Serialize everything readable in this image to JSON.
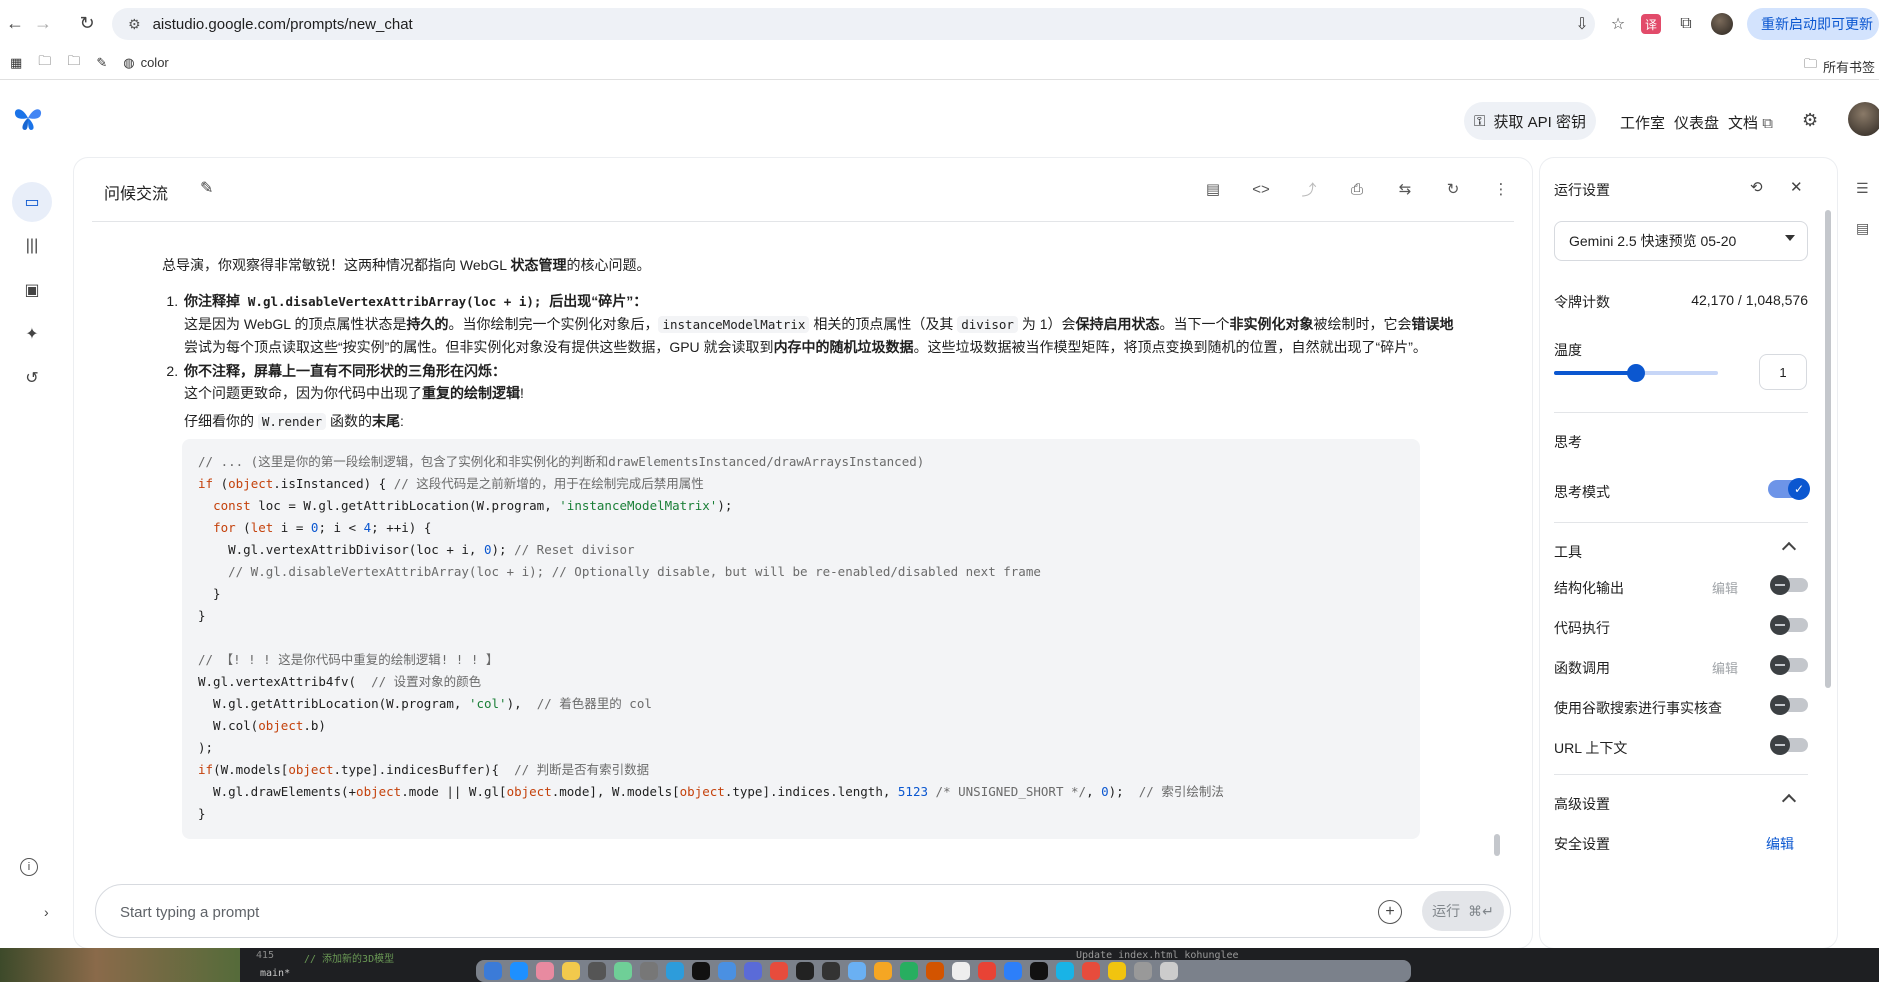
{
  "browser": {
    "url": "aistudio.google.com/prompts/new_chat",
    "update_label": "重新启动即可更新",
    "bookmarks": {
      "color": "color",
      "all_bookmarks": "所有书签"
    }
  },
  "header": {
    "api_key_label": "获取 API 密钥",
    "studio": "工作室",
    "dashboard": "仪表盘",
    "docs": "文档"
  },
  "chat": {
    "title": "问候交流",
    "intro_pre": "总导演，你观察得非常敏锐！这两种情况都指向 WebGL ",
    "intro_bold": "状态管理",
    "intro_post": "的核心问题。",
    "p1_head_pre": "你注释掉 ",
    "p1_head_code": "W.gl.disableVertexAttribArray(loc + i);",
    "p1_head_post": " 后出现“碎片”：",
    "p1_a": "这是因为 WebGL 的顶点属性状态是",
    "p1_b": "持久的",
    "p1_c": "。当你绘制完一个实例化对象后，",
    "p1_code1": "instanceModelMatrix",
    "p1_d": " 相关的顶点属性（及其 ",
    "p1_code2": "divisor",
    "p1_e": " 为 1）会",
    "p1_f": "保持启用状态",
    "p1_g": "。当下一个",
    "p1_h": "非实例化对象",
    "p1_i": "被绘制时，它会",
    "p1_j": "错误地",
    "p1_k": "尝试为每个顶点读取这些“按实例”的属性。但非实例化对象没有提供这些数据，GPU 就会读取到",
    "p1_l": "内存中的随机垃圾数据",
    "p1_m": "。这些垃圾数据被当作模型矩阵，将顶点变换到随机的位置，自然就出现了“碎片”。",
    "p2_head": "你不注释，屏幕上一直有不同形状的三角形在闪烁：",
    "p2_a": "这个问题更致命，因为你代码中出现了",
    "p2_b": "重复的绘制逻辑",
    "p2_c": "!",
    "p3_a": "仔细看你的 ",
    "p3_code": "W.render",
    "p3_b": " 函数的",
    "p3_c": "末尾",
    "p3_d": ":"
  },
  "code_lines": [
    "// ... (这里是你的第一段绘制逻辑，包含了实例化和非实例化的判断和drawElementsInstanced/drawArraysInstanced)",
    "if (object.isInstanced) { // 这段代码是之前新增的，用于在绘制完成后禁用属性",
    "  const loc = W.gl.getAttribLocation(W.program, 'instanceModelMatrix');",
    "  for (let i = 0; i < 4; ++i) {",
    "    W.gl.vertexAttribDivisor(loc + i, 0); // Reset divisor",
    "    // W.gl.disableVertexAttribArray(loc + i); // Optionally disable, but will be re-enabled/disabled next frame",
    "  }",
    "}",
    "",
    "// 【! ! ! 这是你代码中重复的绘制逻辑! ! ! 】",
    "W.gl.vertexAttrib4fv(  // 设置对象的颜色",
    "  W.gl.getAttribLocation(W.program, 'col'),  // 着色器里的 col",
    "  W.col(object.b)",
    ");",
    "if(W.models[object.type].indicesBuffer){  // 判断是否有索引数据",
    "  W.gl.drawElements(+object.mode || W.gl[object.mode], W.models[object.type].indices.length, 5123 /* UNSIGNED_SHORT */, 0);  // 索引绘制法",
    "}"
  ],
  "prompt": {
    "placeholder": "Start typing a prompt",
    "run_label": "运行",
    "shortcut": "⌘↵"
  },
  "settings": {
    "title": "运行设置",
    "model": "Gemini 2.5 快速预览 05-20",
    "token_label": "令牌计数",
    "token_value": "42,170 / 1,048,576",
    "temperature_label": "温度",
    "temperature_value": "1",
    "temperature_level": 0.5,
    "thinking": "思考",
    "thinking_mode": "思考模式",
    "tools": "工具",
    "structured_output": "结构化输出",
    "code_execution": "代码执行",
    "function_calling": "函数调用",
    "grounding": "使用谷歌搜索进行事实核查",
    "url_context": "URL 上下文",
    "edit": "编辑",
    "advanced": "高级设置",
    "safety": "安全设置",
    "safety_edit": "编辑"
  },
  "taskbar": {
    "line_no": "415",
    "line_comment": "// 添加新的3D模型",
    "branch": "main*",
    "commit": "Update index.html   kohunglee"
  },
  "colors": {
    "accent": "#0b57d0",
    "code_bg": "#f3f4f6"
  }
}
